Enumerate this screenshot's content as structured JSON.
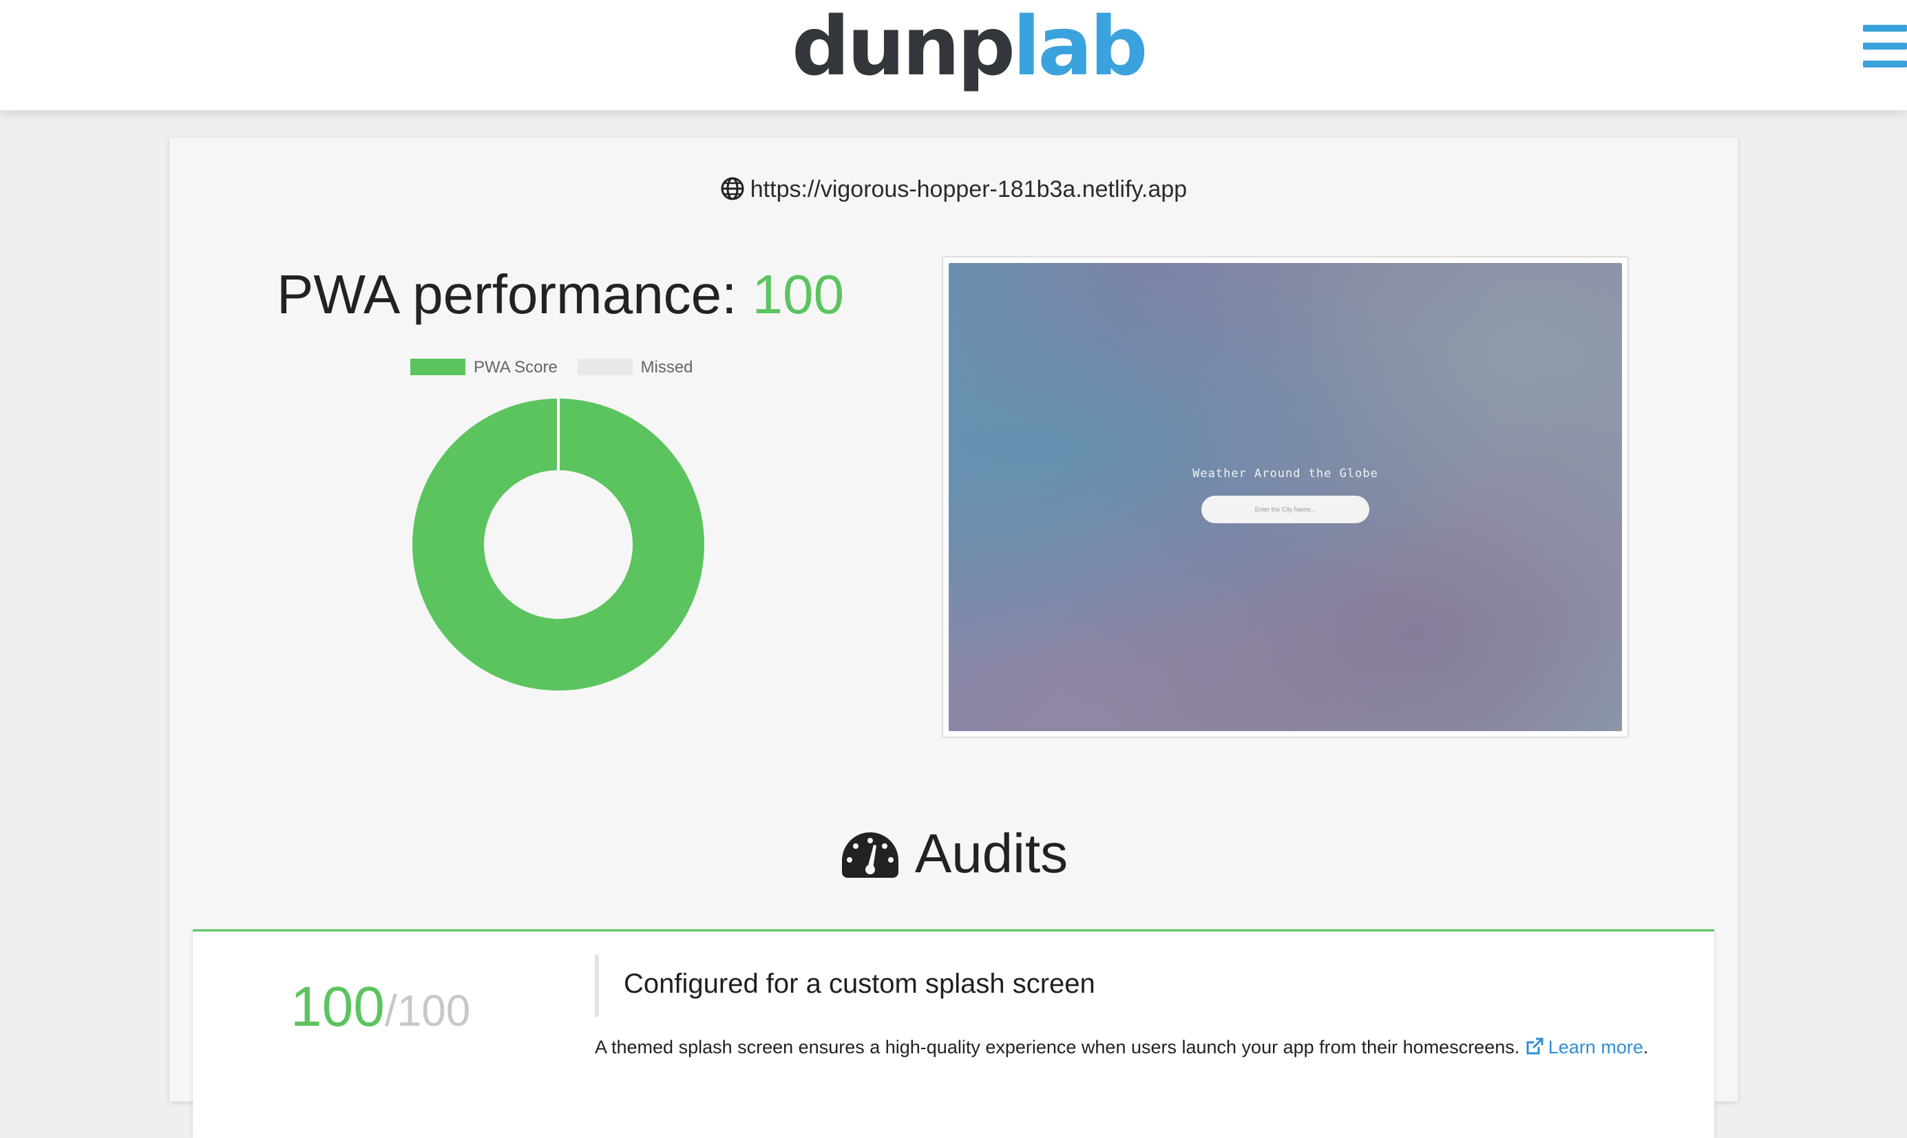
{
  "header": {
    "logo_part1": "dunp",
    "logo_part2": "lab",
    "menu_icon": "hamburger-menu-icon",
    "brand_colors": {
      "dark": "#33363b",
      "blue": "#3aa2dc"
    }
  },
  "report": {
    "url": "https://vigorous-hopper-181b3a.netlify.app",
    "url_icon": "globe-icon",
    "performance_label": "PWA performance: ",
    "performance_score": "100"
  },
  "chart_data": {
    "type": "pie",
    "variant": "doughnut",
    "legend_position": "top",
    "labels": [
      "PWA Score",
      "Missed"
    ],
    "values": [
      100,
      0
    ],
    "colors": [
      "#5bc45f",
      "#e8e8e8"
    ]
  },
  "preview": {
    "title": "Weather Around the Globe",
    "input_placeholder": "Enter the City Name..."
  },
  "audits": {
    "heading": "Audits",
    "heading_icon": "speedometer-icon",
    "items": [
      {
        "score": "100",
        "max": "/100",
        "title": "Configured for a custom splash screen",
        "description": "A themed splash screen ensures a high-quality experience when users launch your app from their homescreens.",
        "link_icon": "external-link-icon",
        "link_text": "Learn more",
        "trailing": "."
      }
    ]
  },
  "colors": {
    "accent_green": "#5bc45f",
    "link_blue": "#2f8ed8"
  }
}
